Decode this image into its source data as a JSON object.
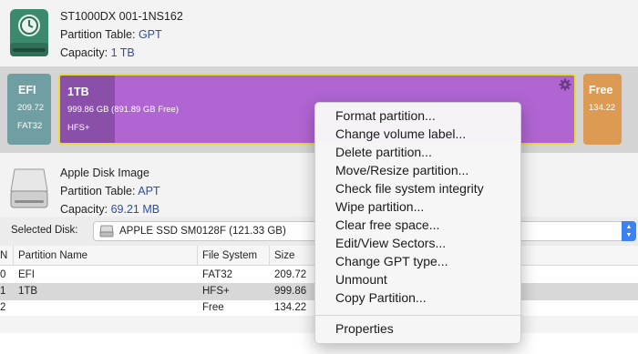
{
  "disk1": {
    "name": "ST1000DX 001-1NS162",
    "partition_table_label": "Partition Table: ",
    "partition_table_value": "GPT",
    "capacity_label": "Capacity: ",
    "capacity_value": "1 TB"
  },
  "partitions": [
    {
      "name": "EFI",
      "size": "209.72",
      "fs": "FAT32",
      "color": "#6f9ea3"
    },
    {
      "name": "1TB",
      "size": "999.86 GB (891.89 GB Free)",
      "fs": "HFS+",
      "color": "#b065d2"
    },
    {
      "name": "Free",
      "size": "134.22",
      "fs": "",
      "color": "#dd9a52"
    }
  ],
  "disk2": {
    "name": "Apple Disk Image",
    "partition_table_label": "Partition Table: ",
    "partition_table_value": "APT",
    "capacity_label": "Capacity: ",
    "capacity_value": "69.21 MB"
  },
  "selected_disk": {
    "label": "Selected Disk:",
    "value": "APPLE SSD SM0128F (121.33 GB)"
  },
  "table": {
    "columns": [
      "N",
      "Partition Name",
      "File System",
      "Size"
    ],
    "rows": [
      [
        "0",
        "EFI",
        "FAT32",
        "209.72"
      ],
      [
        "1",
        "1TB",
        "HFS+",
        "999.86"
      ],
      [
        "2",
        "",
        "Free",
        "134.22"
      ]
    ]
  },
  "context_menu": {
    "items": [
      "Format partition...",
      "Change volume label...",
      "Delete partition...",
      "Move/Resize partition...",
      "Check file system integrity",
      "Wipe partition...",
      "Clear free space...",
      "Edit/View Sectors...",
      "Change GPT type...",
      "Unmount",
      "Copy Partition..."
    ],
    "last_item": "Properties"
  },
  "colors": {
    "accent": "#3d82f3",
    "selection_border": "#e6dc2b",
    "link_value": "#2c4fa3"
  }
}
